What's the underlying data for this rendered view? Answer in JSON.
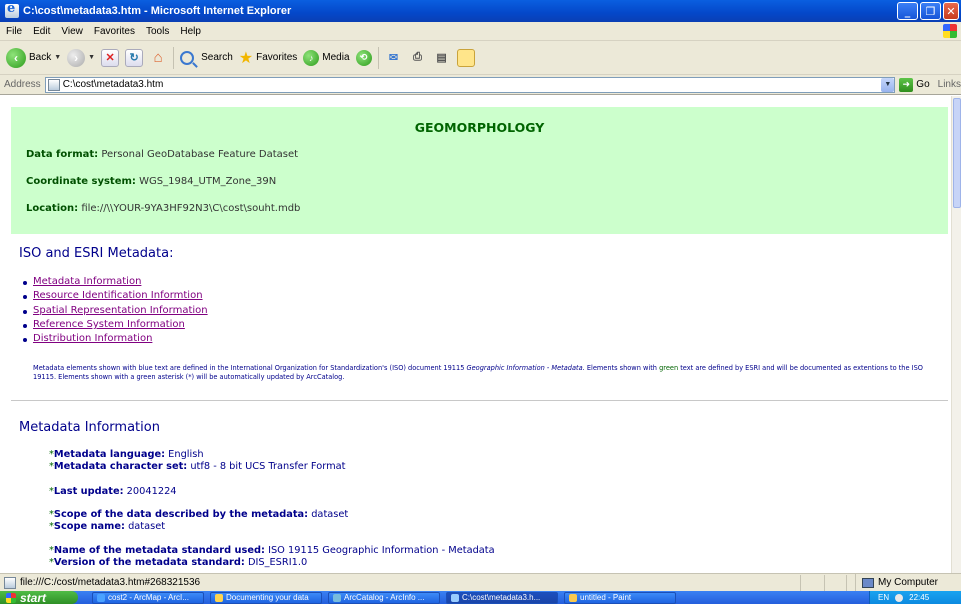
{
  "window": {
    "title": "C:\\cost\\metadata3.htm - Microsoft Internet Explorer"
  },
  "menu": [
    "File",
    "Edit",
    "View",
    "Favorites",
    "Tools",
    "Help"
  ],
  "toolbar": {
    "back": "Back",
    "search": "Search",
    "favorites": "Favorites",
    "media": "Media"
  },
  "address": {
    "label": "Address",
    "value": "C:\\cost\\metadata3.htm",
    "go": "Go",
    "links": "Links"
  },
  "page": {
    "heading": "GEOMORPHOLOGY",
    "data_format_label": "Data format:",
    "data_format": "Personal GeoDatabase Feature Dataset",
    "coord_label": "Coordinate system:",
    "coord": "WGS_1984_UTM_Zone_39N",
    "location_label": "Location:",
    "location": "file://\\\\YOUR-9YA3HF92N3\\C\\cost\\souht.mdb",
    "iso_title": "ISO and ESRI Metadata:",
    "iso_links": [
      "Metadata Information",
      "Resource Identification Informtion",
      "Spatial Representation Information",
      "Reference System Information",
      "Distribution Information"
    ],
    "note_1": "Metadata elements shown with blue text are defined in the International Organization for Standardization's (ISO) document 19115 ",
    "note_italic": "Geographic Information - Metadata",
    "note_2": ". Elements shown with ",
    "note_green": "green",
    "note_3": " text are defined by ESRI and will be documented as extentions to the ISO 19115. Elements shown with a green asterisk (*) will be automatically updated by ArcCatalog.",
    "mi_title": "Metadata Information",
    "mi_rows": [
      {
        "label": "Metadata language:",
        "value": "English"
      },
      {
        "label": "Metadata character set:",
        "value": "utf8 - 8 bit UCS Transfer Format"
      },
      {
        "label": "Last update:",
        "value": "20041224"
      },
      {
        "label": "Scope of the data described by the metadata:",
        "value": "dataset"
      },
      {
        "label": "Scope name:",
        "value": "dataset"
      },
      {
        "label": "Name of the metadata standard used:",
        "value": "ISO 19115 Geographic Information - Metadata"
      },
      {
        "label": "Version of the metadata standard:",
        "value": "DIS_ESRI1.0"
      }
    ],
    "asterisk": "*"
  },
  "status": {
    "url": "file:///C:/cost/metadata3.htm#268321536",
    "zone": "My Computer"
  },
  "taskbar": {
    "start": "start",
    "tasks": [
      "cost2 - ArcMap - ArcI...",
      "Documenting your data",
      "ArcCatalog - ArcInfo ...",
      "C:\\cost\\metadata3.h...",
      "untitled - Paint"
    ],
    "lang": "EN",
    "clock": "22:45"
  }
}
